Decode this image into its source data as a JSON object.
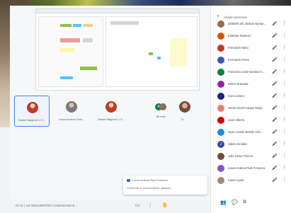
{
  "stage": {
    "tiles": [
      {
        "name": "Daniel Balgrind U S..."
      },
      {
        "name": "Laura Andrea Ruiz..."
      },
      {
        "name": "Daniel Balgrind U S..."
      }
    ],
    "more_label": "86 más",
    "tu_label": "Tú",
    "pair_initial": "A"
  },
  "toast": {
    "sender": "Laura Andrea Ruiz Fonseca",
    "message": "Confirmar el conocimiento, gracias"
  },
  "bottombar": {
    "time_title": "07:11  |  1er ENCUENTRO CIUDADANO E...",
    "icons": [
      "captions-icon",
      "more-icon",
      "hand-icon",
      "info-icon",
      "people-icon",
      "chat-icon",
      "activities-icon"
    ]
  },
  "people": {
    "add_label": "Añadir personas",
    "participants": [
      {
        "name": "DOBON DE JESUS Nariae...",
        "color": "#9e6b4a",
        "initial": ""
      },
      {
        "name": "Esteban Ramirez",
        "color": "#d35400",
        "initial": ""
      },
      {
        "name": "Fernando Nieto",
        "color": "#c0392b",
        "initial": ""
      },
      {
        "name": "Fernando Perez",
        "color": "#3f51b5",
        "initial": ""
      },
      {
        "name": "Francisco José Narváez C...",
        "color": "#0b8043",
        "initial": ""
      },
      {
        "name": "Helen Granada",
        "color": "#8e24aa",
        "initial": ""
      },
      {
        "name": "Ivan Lozano",
        "color": "#1a237e",
        "initial": ""
      },
      {
        "name": "Jesús David Araque Mejia",
        "color": "#e67c73",
        "initial": ""
      },
      {
        "name": "Juan Alberto",
        "color": "#d50000",
        "initial": ""
      },
      {
        "name": "Juan Camilo Botello Cifu...",
        "color": "#1e88e5",
        "initial": ""
      },
      {
        "name": "Julián escobar",
        "color": "#3949ab",
        "initial": "J"
      },
      {
        "name": "Julio Cesar Pinzon",
        "color": "#6d4c41",
        "initial": ""
      },
      {
        "name": "Laura Andrea Ruiz Fonseca",
        "color": "#7e57c2",
        "initial": ""
      },
      {
        "name": "Laura Ayala",
        "color": "#a1887f",
        "initial": ""
      }
    ]
  }
}
